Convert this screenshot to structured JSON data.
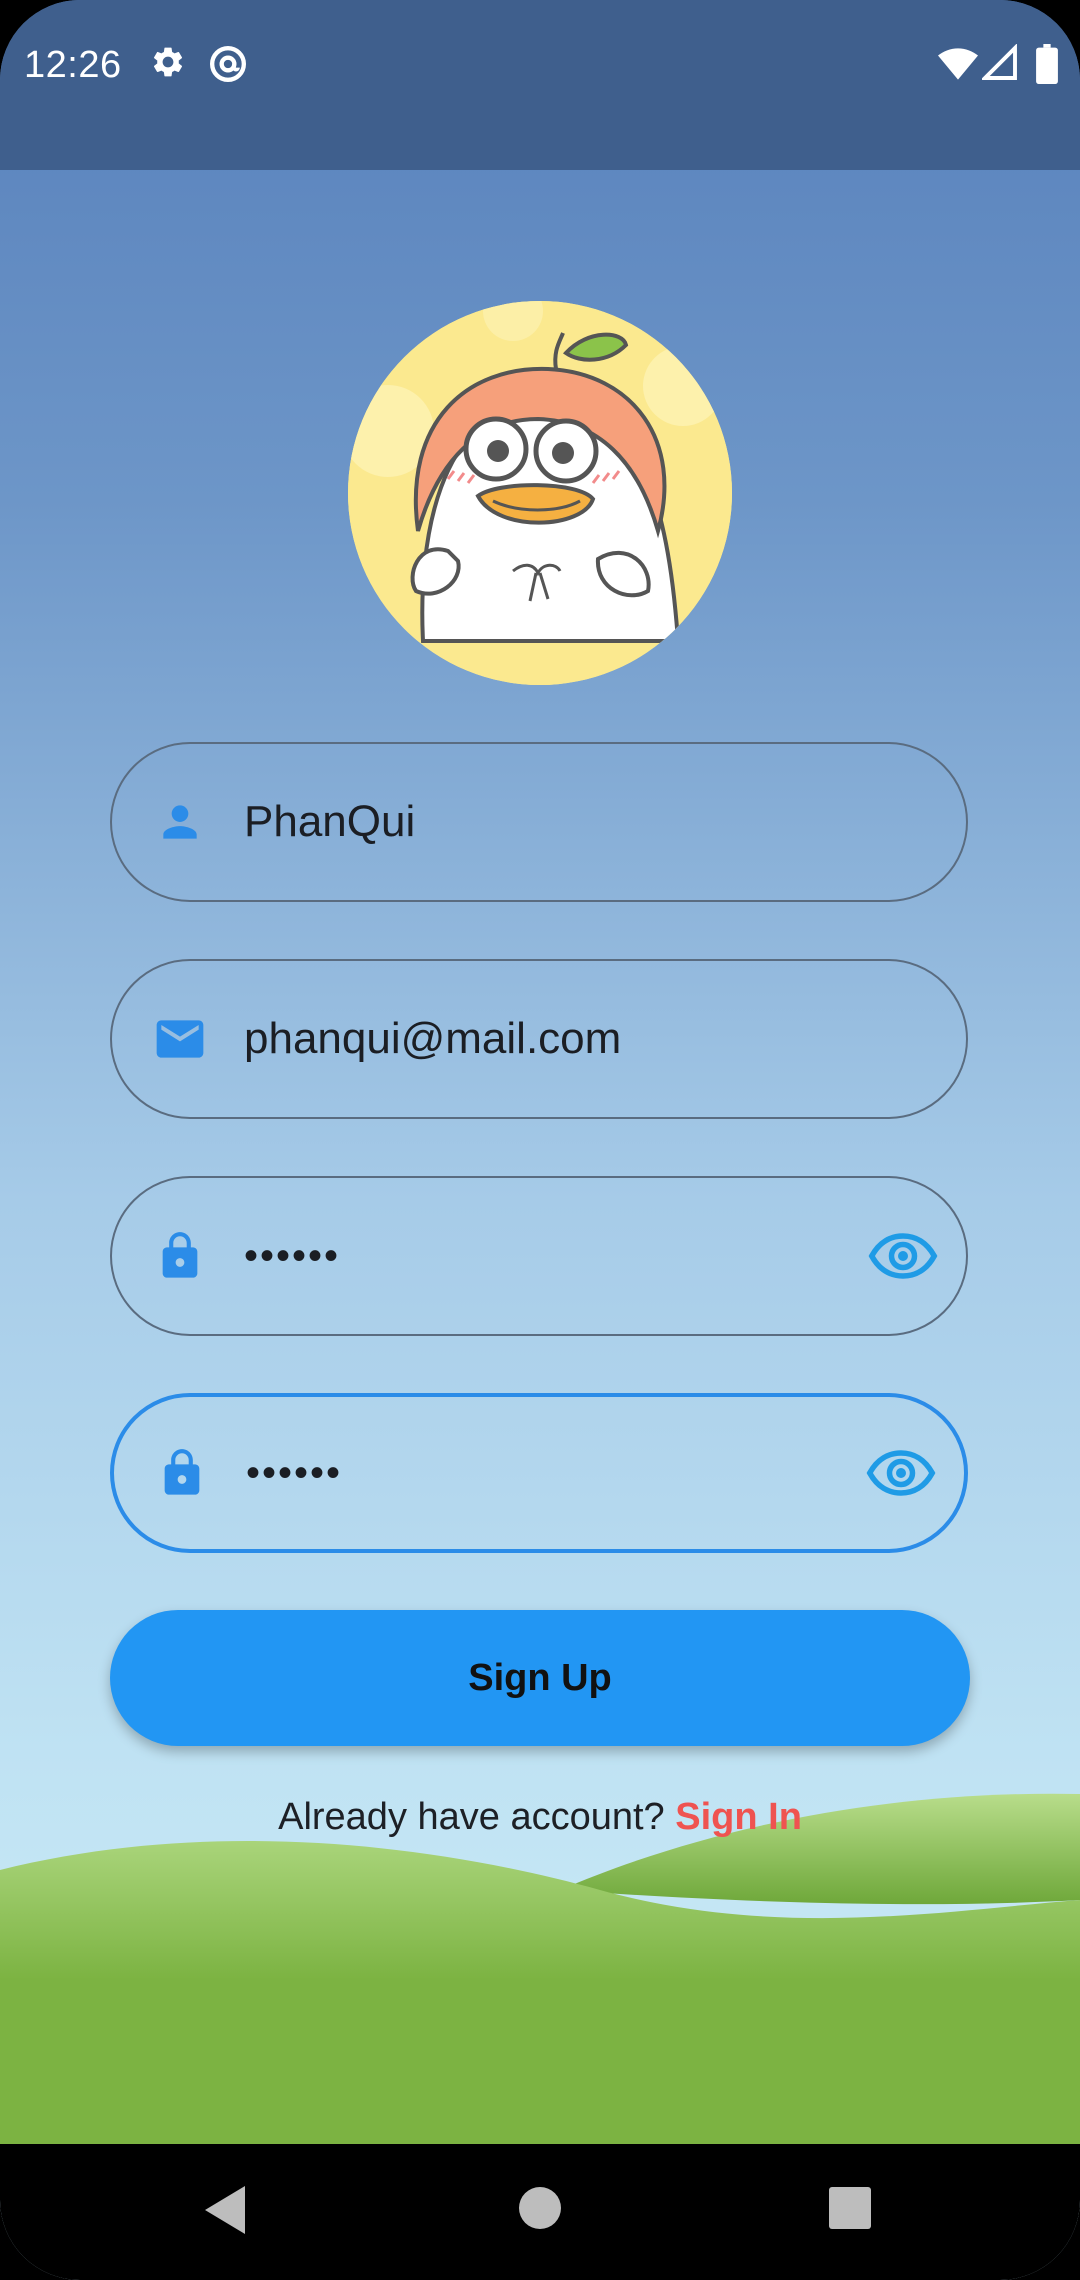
{
  "status_bar": {
    "time": "12:26",
    "left_icons": [
      "gear-icon",
      "at-sign-icon"
    ],
    "right_icons": [
      "wifi-icon",
      "signal-icon",
      "battery-icon"
    ]
  },
  "avatar": {
    "description_icon": "duck-avatar"
  },
  "form": {
    "username": {
      "value": "PhanQui",
      "icon": "person-icon"
    },
    "email": {
      "value": "phanqui@mail.com",
      "icon": "mail-icon"
    },
    "password": {
      "value": "••••••",
      "icon": "lock-icon",
      "toggle_icon": "eye-icon"
    },
    "confirm_password": {
      "value": "••••••",
      "icon": "lock-icon",
      "toggle_icon": "eye-icon"
    }
  },
  "signup_button": {
    "label": "Sign Up"
  },
  "signin_prompt": {
    "text": "Already have account? ",
    "link": "Sign In"
  },
  "colors": {
    "accent": "#2296f3",
    "link": "#ef5350",
    "status_bar": "#3f5f8d",
    "hill_green": "#7cb342"
  }
}
